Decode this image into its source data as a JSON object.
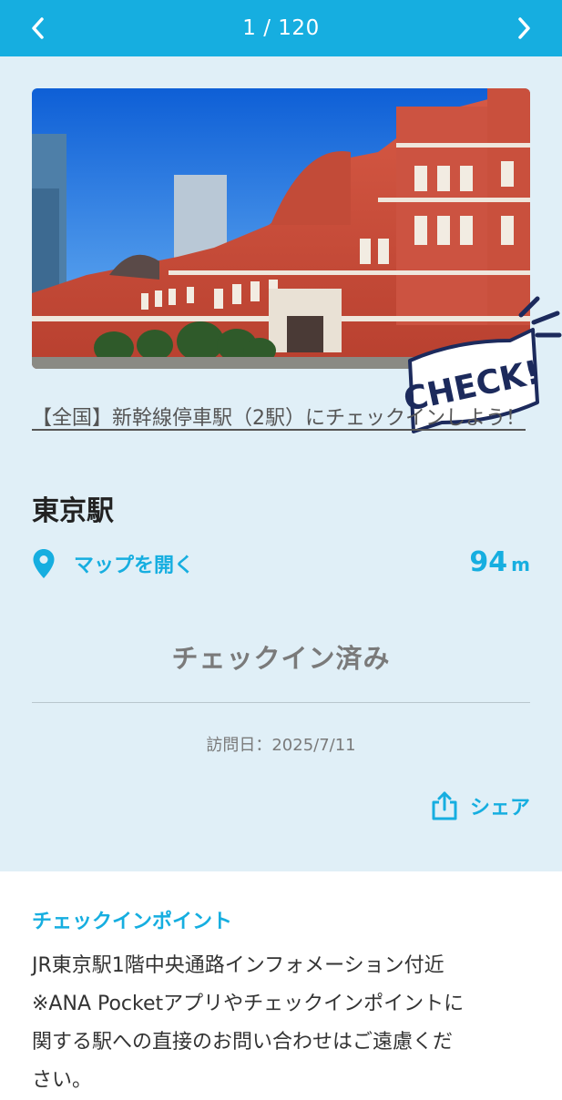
{
  "header": {
    "counter": "1 / 120",
    "prev_icon": "chevron-left-icon",
    "next_icon": "chevron-right-icon",
    "color": "#16aee0"
  },
  "card": {
    "image_alt": "東京駅",
    "badge_text": "CHECK!",
    "campaign_link": "【全国】新幹線停車駅（2駅）にチェックインしよう！",
    "station_name": "東京駅",
    "map_label": "マップを開く",
    "distance_value": "94",
    "distance_unit": "m",
    "status": "チェックイン済み",
    "visit_date": "訪問日：2025/7/11",
    "share_label": "シェア",
    "background": "#e0eff7"
  },
  "checkin_point": {
    "title": "チェックインポイント",
    "lines": [
      "JR東京駅1階中央通路インフォメーション付近",
      "※ANA Pocketアプリやチェックインポイントに",
      "関する駅への直接のお問い合わせはご遠慮くだ",
      "さい。"
    ]
  }
}
